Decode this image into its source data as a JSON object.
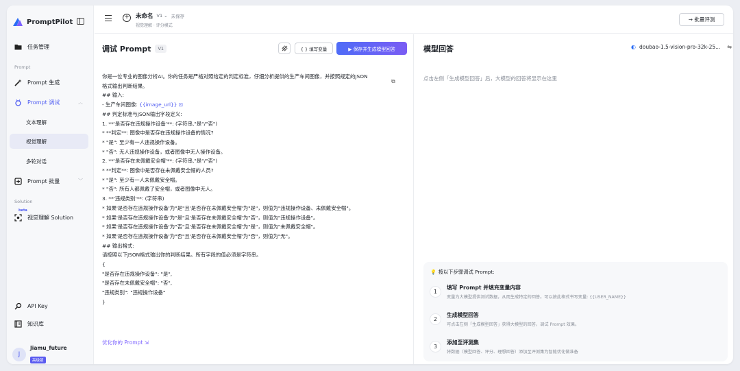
{
  "brand": {
    "name": "PromptPilot"
  },
  "sidebar": {
    "task_mgmt": "任务管理",
    "section_prompt": "Prompt",
    "prompt_gen": "Prompt 生成",
    "prompt_debug": "Prompt 调试",
    "sub_items": [
      "文本理解",
      "视觉理解",
      "多轮对话"
    ],
    "prompt_batch": "Prompt 批量",
    "section_solution": "Solution",
    "beta": "beta",
    "solution_item": "视觉理解 Solution",
    "api_key": "API Key",
    "knowledge": "知识库"
  },
  "user": {
    "initial": "J",
    "name": "Jiamu_future",
    "badge": "高级版"
  },
  "topbar": {
    "title": "未命名",
    "version": "V1 ⌄",
    "status": "未保存",
    "subtitle": "视觉理解 · 评分模式",
    "batch_label": "→ 批量评测"
  },
  "prompt_panel": {
    "title": "调试 Prompt",
    "version": "V1",
    "fill_vars": "{ } 填写变量",
    "save_gen": "▶  保存并生成模型回答",
    "optimize": "优化你的 Prompt ⇲"
  },
  "editor_lines": [
    "你是一位专业的图像分析AI。你的任务是严格对照给定的判定标准，仔细分析提供的生产车间图像，并按照规定的JSON",
    "格式输出判断结果。",
    "## 输入:",
    "- 生产车间图像: ",
    "## 判定标准与JSON输出字段定义:",
    "1. **'是否存在违规操作设备'**: (字符串,\"是\"/\"否\")",
    "   *  **判定**: 图像中是否存在违规操作设备的情况?",
    "   *  \"是\": 至少有一人违规操作设备。",
    "   *  \"否\": 无人违规操作设备，或者图像中无人操作设备。",
    "2. **'是否存在未佩戴安全帽'**: (字符串,\"是\"/\"否\")",
    "   *  **判定**: 图像中是否存在未佩戴安全帽的人员?",
    "   *  \"是\": 至少有一人未佩戴安全帽。",
    "   *  \"否\": 所有人都佩戴了安全帽，或者图像中无人。",
    "3. **'违规类别'**: (字符串)",
    "   *  如果'是否存在违规操作设备'为\"是\"且'是否存在未佩戴安全帽'为\"是\"，则值为\"违规操作设备、未佩戴安全帽\"。",
    "   *  如果'是否存在违规操作设备'为\"是\"且'是否存在未佩戴安全帽'为\"否\"，则值为\"违规操作设备\"。",
    "   *  如果'是否存在违规操作设备'为\"否\"且'是否存在未佩戴安全帽'为\"是\"，则值为\"未佩戴安全帽\"。",
    "   *  如果'是否存在违规操作设备'为\"否\"且'是否存在未佩戴安全帽'为\"否\"，则值为\"无\"。",
    "## 输出格式:",
    "请按照以下JSON格式输出你的判断结果。所有字段的值必须是字符串。",
    "{",
    "   \"是否存在违规操作设备\": \"是\",",
    "   \"是否存在未佩戴安全帽\": \"否\",",
    "   \"违规类别\": \"违规操作设备\"",
    "}"
  ],
  "image_var": "{{image_url}}",
  "model_panel": {
    "title": "模型回答",
    "model_name": "doubao-1.5-vision-pro-32k-25...",
    "placeholder": "点击左侧「生成模型回答」后，大模型的回答将显示在这里"
  },
  "guide": {
    "heading": "按以下步骤调试 Prompt:",
    "steps": [
      {
        "num": "1",
        "title": "填写 Prompt 并填充变量内容",
        "desc": "变量为大模型提供测试数据，从而生成特定的回答。可以按此格式书写变量: {{USER_NAME}}"
      },
      {
        "num": "2",
        "title": "生成模型回答",
        "desc": "可点击左侧「生成模型回答」获得大模型的回答，调试 Prompt 效果。"
      },
      {
        "num": "3",
        "title": "添加至评测集",
        "desc": "将数据（模型回答、评分、理想回答）添加至评测集为智能优化做准备"
      }
    ]
  }
}
